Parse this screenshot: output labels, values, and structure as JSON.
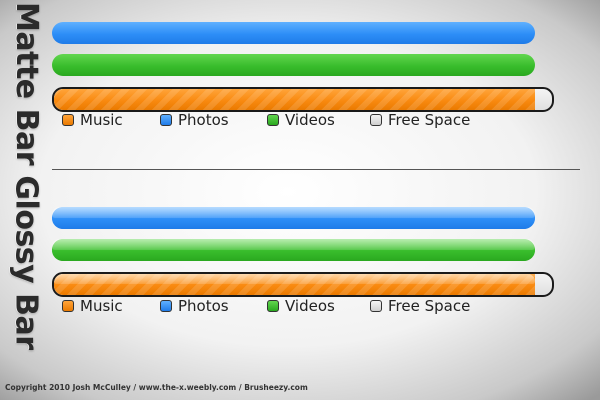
{
  "sections": [
    {
      "title": "Matte Bar",
      "usage": {
        "music": 0.965,
        "free": 0.035
      },
      "legend": {
        "music": "Music",
        "photos": "Photos",
        "videos": "Videos",
        "free": "Free Space"
      }
    },
    {
      "title": "Glossy Bar",
      "usage": {
        "music": 0.965,
        "free": 0.035
      },
      "legend": {
        "music": "Music",
        "photos": "Photos",
        "videos": "Videos",
        "free": "Free Space"
      }
    }
  ],
  "colors": {
    "music": "#f98a10",
    "photos": "#2d8ef7",
    "videos": "#39bd2c",
    "free": "#e0e0e0"
  },
  "footer": "Copyright 2010 Josh McCulley / www.the-x.weebly.com / Brusheezy.com"
}
